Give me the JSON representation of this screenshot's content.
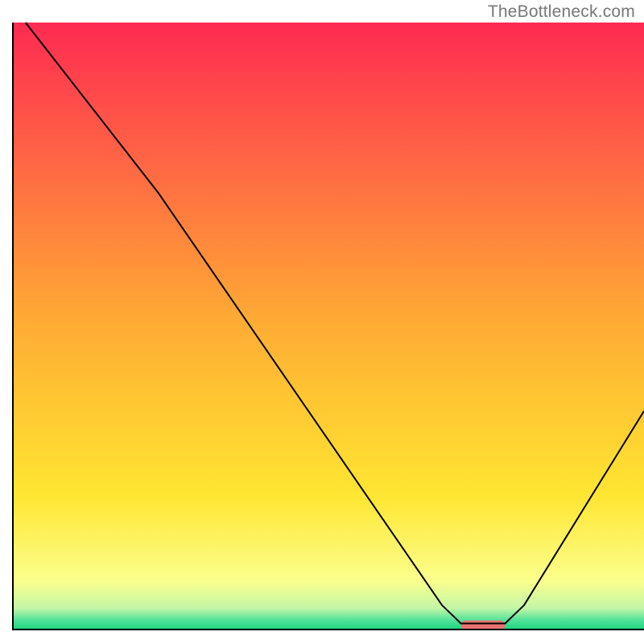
{
  "watermark": "TheBottleneck.com",
  "chart_data": {
    "type": "line",
    "title": "",
    "xlabel": "",
    "ylabel": "",
    "xlim": [
      0,
      100
    ],
    "ylim": [
      0,
      100
    ],
    "gradient_stops": [
      {
        "offset": 0.0,
        "color": "#ff2a52"
      },
      {
        "offset": 0.5,
        "color": "#ffad33"
      },
      {
        "offset": 0.78,
        "color": "#ffe632"
      },
      {
        "offset": 0.92,
        "color": "#fbff8c"
      },
      {
        "offset": 0.965,
        "color": "#c3f6a6"
      },
      {
        "offset": 0.985,
        "color": "#4fe29a"
      },
      {
        "offset": 1.0,
        "color": "#1cd47c"
      }
    ],
    "axis": {
      "stroke": "#000000",
      "width": 2
    },
    "series": [
      {
        "name": "bottleneck-curve",
        "stroke": "#000000",
        "strokeWidth": 2,
        "points": [
          {
            "x": 2,
            "y": 100
          },
          {
            "x": 23,
            "y": 72
          },
          {
            "x": 68,
            "y": 4
          },
          {
            "x": 71,
            "y": 1
          },
          {
            "x": 78,
            "y": 1
          },
          {
            "x": 81,
            "y": 4
          },
          {
            "x": 100,
            "y": 36
          }
        ]
      }
    ],
    "marker": {
      "name": "optimal-marker",
      "color": "#e87472",
      "x1": 71,
      "x2": 78,
      "y": 0.7,
      "height": 1.6,
      "radius_pct": 0.8
    }
  }
}
